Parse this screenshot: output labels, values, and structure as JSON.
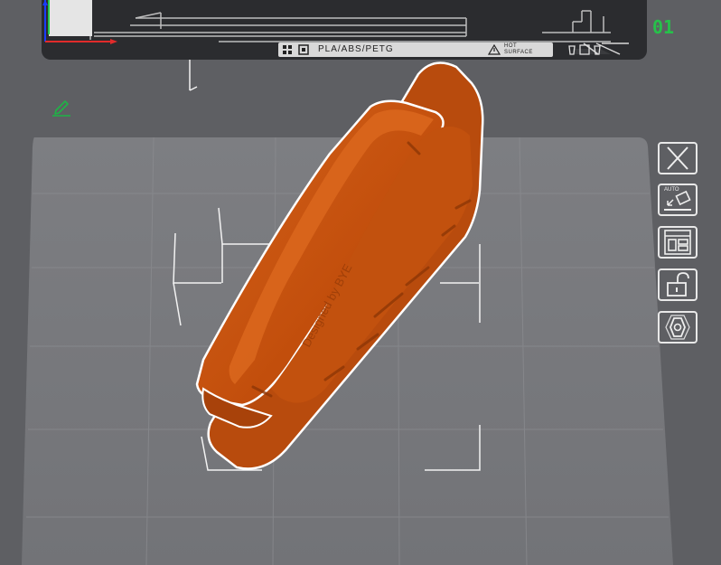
{
  "printer": {
    "material": "PLA/ABS/PETG",
    "surface_line1": "HOT",
    "surface_line2": "SURFACE",
    "plate_id": "01"
  },
  "model": {
    "embossed_text": "Designed by BYE"
  },
  "toolbar": {
    "auto_label": "AUTO"
  },
  "colors": {
    "background": "#5e5f63",
    "bed": "#7b7c81",
    "model": "#c9530f",
    "accent_badge": "#26c14a",
    "edit_icon": "#1fb346"
  },
  "icons": {
    "edit": "pencil-edit-icon",
    "close": "close-icon",
    "auto_orient": "auto-orient-icon",
    "arrange": "arrange-icon",
    "lock": "unlock-icon",
    "settings": "hexagon-settings-icon"
  }
}
